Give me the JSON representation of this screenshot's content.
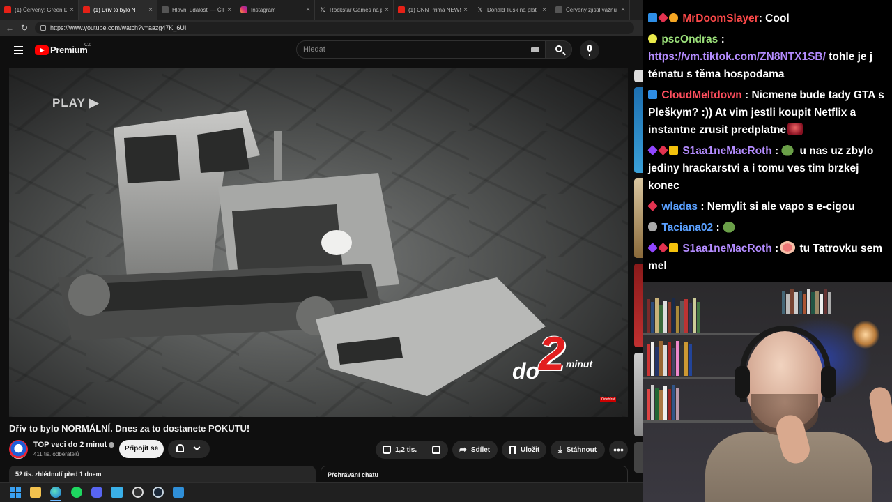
{
  "browser": {
    "tabs": [
      {
        "label": "(1) Červený: Green D",
        "icon": "youtube-icon",
        "active": false
      },
      {
        "label": "(1) Dřív to bylo N",
        "icon": "youtube-icon",
        "active": true
      },
      {
        "label": "Hlavní události — ČT",
        "icon": "page-icon",
        "active": false
      },
      {
        "label": "Instagram",
        "icon": "instagram-icon",
        "active": false
      },
      {
        "label": "Rockstar Games na p",
        "icon": "x-icon",
        "active": false
      },
      {
        "label": "(1) CNN Prima NEWS",
        "icon": "youtube-icon",
        "active": false
      },
      {
        "label": "Donald Tusk na plat",
        "icon": "x-icon",
        "active": false
      },
      {
        "label": "Červený zjistil vážnu",
        "icon": "page-icon",
        "active": false
      }
    ],
    "url": "https://www.youtube.com/watch?v=aazg47K_6UI"
  },
  "youtube": {
    "brand": "Premium",
    "region": "CZ",
    "search_placeholder": "Hledat"
  },
  "video": {
    "overlay_label": "PLAY",
    "logo_do": "do",
    "logo_two": "2",
    "logo_min": "minut",
    "subscribe_watermark": "Odebírat",
    "title": "Dřív to bylo NORMÁLNÍ. Dnes za to dostanete POKUTU!"
  },
  "channel": {
    "name": "TOP veci do 2 minut",
    "subscribers": "411 tis. odběratelů",
    "join_label": "Připojit se"
  },
  "actions": {
    "likes": "1,2 tis.",
    "share": "Sdílet",
    "save": "Uložit",
    "download": "Stáhnout",
    "more": "•••"
  },
  "description": {
    "meta": "52 tis. zhlédnutí  před 1 dnem"
  },
  "chat_replay": {
    "label": "Přehrávání chatu"
  },
  "stream_chat": [
    {
      "user": "MrDoomSlayer",
      "color": "#ff4a4a",
      "text": ": Cool"
    },
    {
      "user": "pscOndras",
      "color": "#9be07a",
      "text": " :",
      "link": "https://vm.tiktok.com/ZN8NTX1SB/",
      "after": " tohle je j tématu s těma hospodama"
    },
    {
      "user": "CloudMeltdown",
      "color": "#ff4f5e",
      "text": " : Nicmene bude tady GTA s Pleškym? :)) At vim jestli koupit Netflix a instantne zrusit predplatne"
    },
    {
      "user": "S1aa1neMacRoth",
      "color": "#b48cff",
      "text": " :",
      "after": " u nas uz zbylo jediny hrackarstvi a i tomu ves tim brzkej konec"
    },
    {
      "user": "wladas",
      "color": "#5aa0ff",
      "text": " : Nemylit si ale vapo s e-cigou"
    },
    {
      "user": "Taciana02",
      "color": "#5aa0ff",
      "text": " :"
    },
    {
      "user": "S1aa1neMacRoth",
      "color": "#b48cff",
      "text": " :",
      "after": " tu Tatrovku sem mel"
    }
  ]
}
